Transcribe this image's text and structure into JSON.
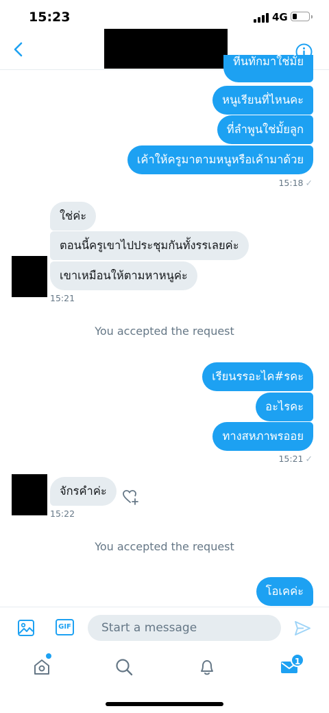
{
  "status_bar": {
    "time": "15:23",
    "network": "4G"
  },
  "messages": {
    "clipped_top": "ที่นทักมาใช่มั้ย",
    "group1": [
      {
        "text": "หนูเรียนที่ไหนคะ"
      },
      {
        "text": "ที่ลำพูนใช่มั้ยลูก"
      },
      {
        "text": "เค้าให้ครูมาตามหนูหรือเค้ามาด้วย"
      }
    ],
    "group1_time": "15:18",
    "group2": [
      {
        "text": "ใช่ค่ะ"
      },
      {
        "text": "ตอนนี้ครูเขาไปประชุมกันทั้งรรเลยค่ะ"
      },
      {
        "text": "เขาเหมือนให้ตามหาหนูค่ะ"
      }
    ],
    "group2_time": "15:21",
    "system1": "You accepted the request",
    "group3": [
      {
        "text": "เรียนรรอะไค#รคะ"
      },
      {
        "text": "อะไรคะ"
      },
      {
        "text": "ทางสหภาพรออย"
      }
    ],
    "group3_time": "15:21",
    "group4": [
      {
        "text": "จักรคำค่ะ"
      }
    ],
    "group4_time": "15:22",
    "system2": "You accepted the request",
    "group5": [
      {
        "text": "โอเคค่ะ"
      }
    ],
    "tick": "✓"
  },
  "composer": {
    "gif_label": "GIF",
    "placeholder": "Start a message"
  },
  "tab_bar": {
    "messages_badge": "1"
  },
  "colors": {
    "accent": "#1da1f2",
    "incoming": "#e6ecf0"
  }
}
